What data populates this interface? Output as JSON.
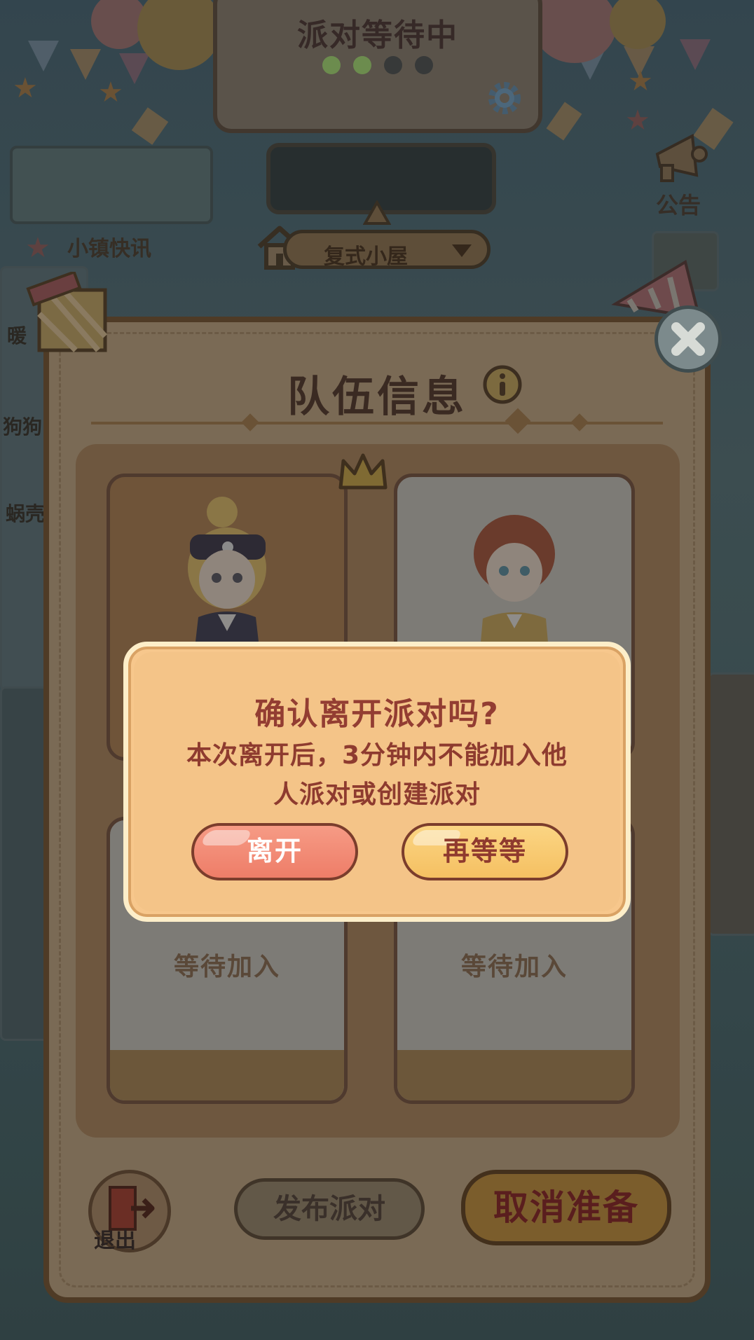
{
  "status_card": {
    "title": "派对等待中",
    "dots": [
      "#7fa55a",
      "#7fa55a",
      "#3f4040",
      "#3f4040"
    ]
  },
  "room_selector": {
    "label": "复式小屋"
  },
  "news": {
    "label": "小镇快讯"
  },
  "announcement": {
    "label": "公告"
  },
  "side_labels": [
    "暖",
    "狗狗",
    "蜗壳"
  ],
  "team_panel": {
    "title": "队伍信息",
    "slots": [
      {
        "type": "member",
        "leader": true,
        "theme": "dark"
      },
      {
        "type": "member",
        "leader": false,
        "theme": "light"
      },
      {
        "type": "empty",
        "label": "等待加入"
      },
      {
        "type": "empty",
        "label": "等待加入"
      }
    ],
    "exit_label": "退出",
    "publish_label": "发布派对",
    "cancel_ready_label": "取消准备"
  },
  "dialog": {
    "title": "确认离开派对吗?",
    "message_line1": "本次离开后，3分钟内不能加入他",
    "message_line2": "人派对或创建派对",
    "leave_label": "离开",
    "wait_label": "再等等"
  },
  "colors": {
    "dialog_bg": "#f4c488",
    "dialog_text": "#933d32",
    "leave_button": "#ee7d68",
    "wait_button": "#f5c062"
  }
}
